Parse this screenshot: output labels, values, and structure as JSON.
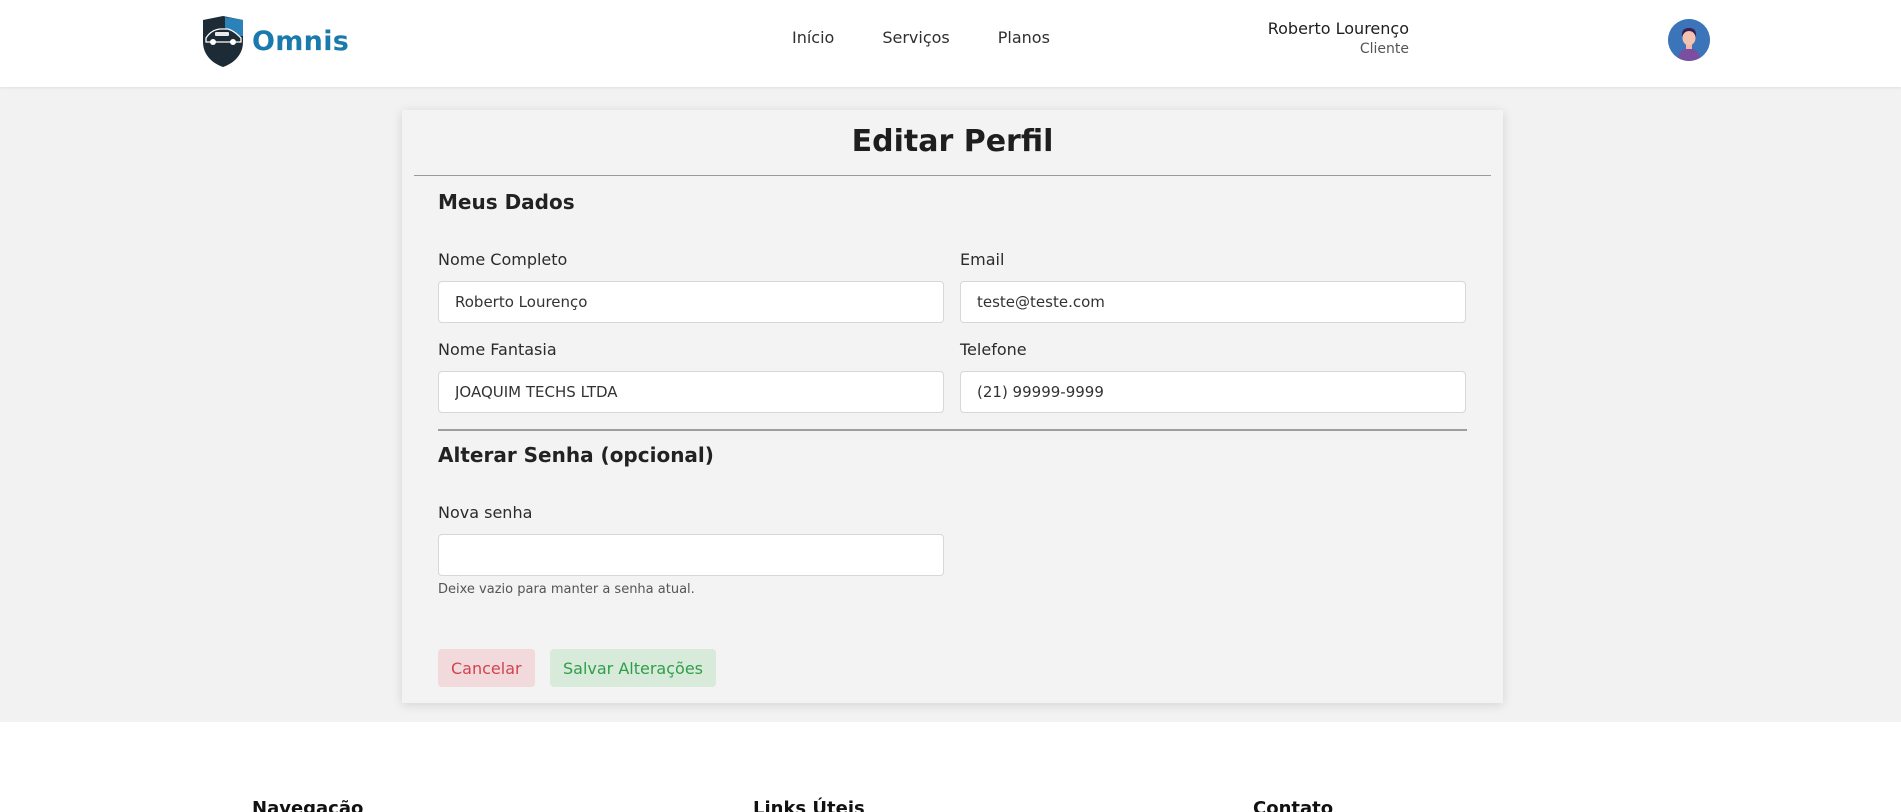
{
  "header": {
    "brand": "Omnis",
    "nav": [
      "Início",
      "Serviços",
      "Planos"
    ],
    "user_name": "Roberto Lourenço",
    "user_role": "Cliente"
  },
  "page": {
    "title": "Editar Perfil",
    "section_data": "Meus Dados",
    "fields": {
      "full_name": {
        "label": "Nome Completo",
        "value": "Roberto Lourenço"
      },
      "email": {
        "label": "Email",
        "value": "teste@teste.com"
      },
      "trade_name": {
        "label": "Nome Fantasia",
        "value": "JOAQUIM TECHS LTDA"
      },
      "phone": {
        "label": "Telefone",
        "value": "(21) 99999-9999"
      }
    },
    "section_password": "Alterar Senha (opcional)",
    "new_password": {
      "label": "Nova senha",
      "value": "",
      "hint": "Deixe vazio para manter a senha atual."
    },
    "cancel_label": "Cancelar",
    "save_label": "Salvar Alterações"
  },
  "footer": {
    "columns": [
      "Navegação",
      "Links Úteis",
      "Contato"
    ]
  },
  "colors": {
    "brand_blue": "#1a7aad",
    "cancel_text": "#d2434f",
    "save_text": "#2f9e4a"
  }
}
